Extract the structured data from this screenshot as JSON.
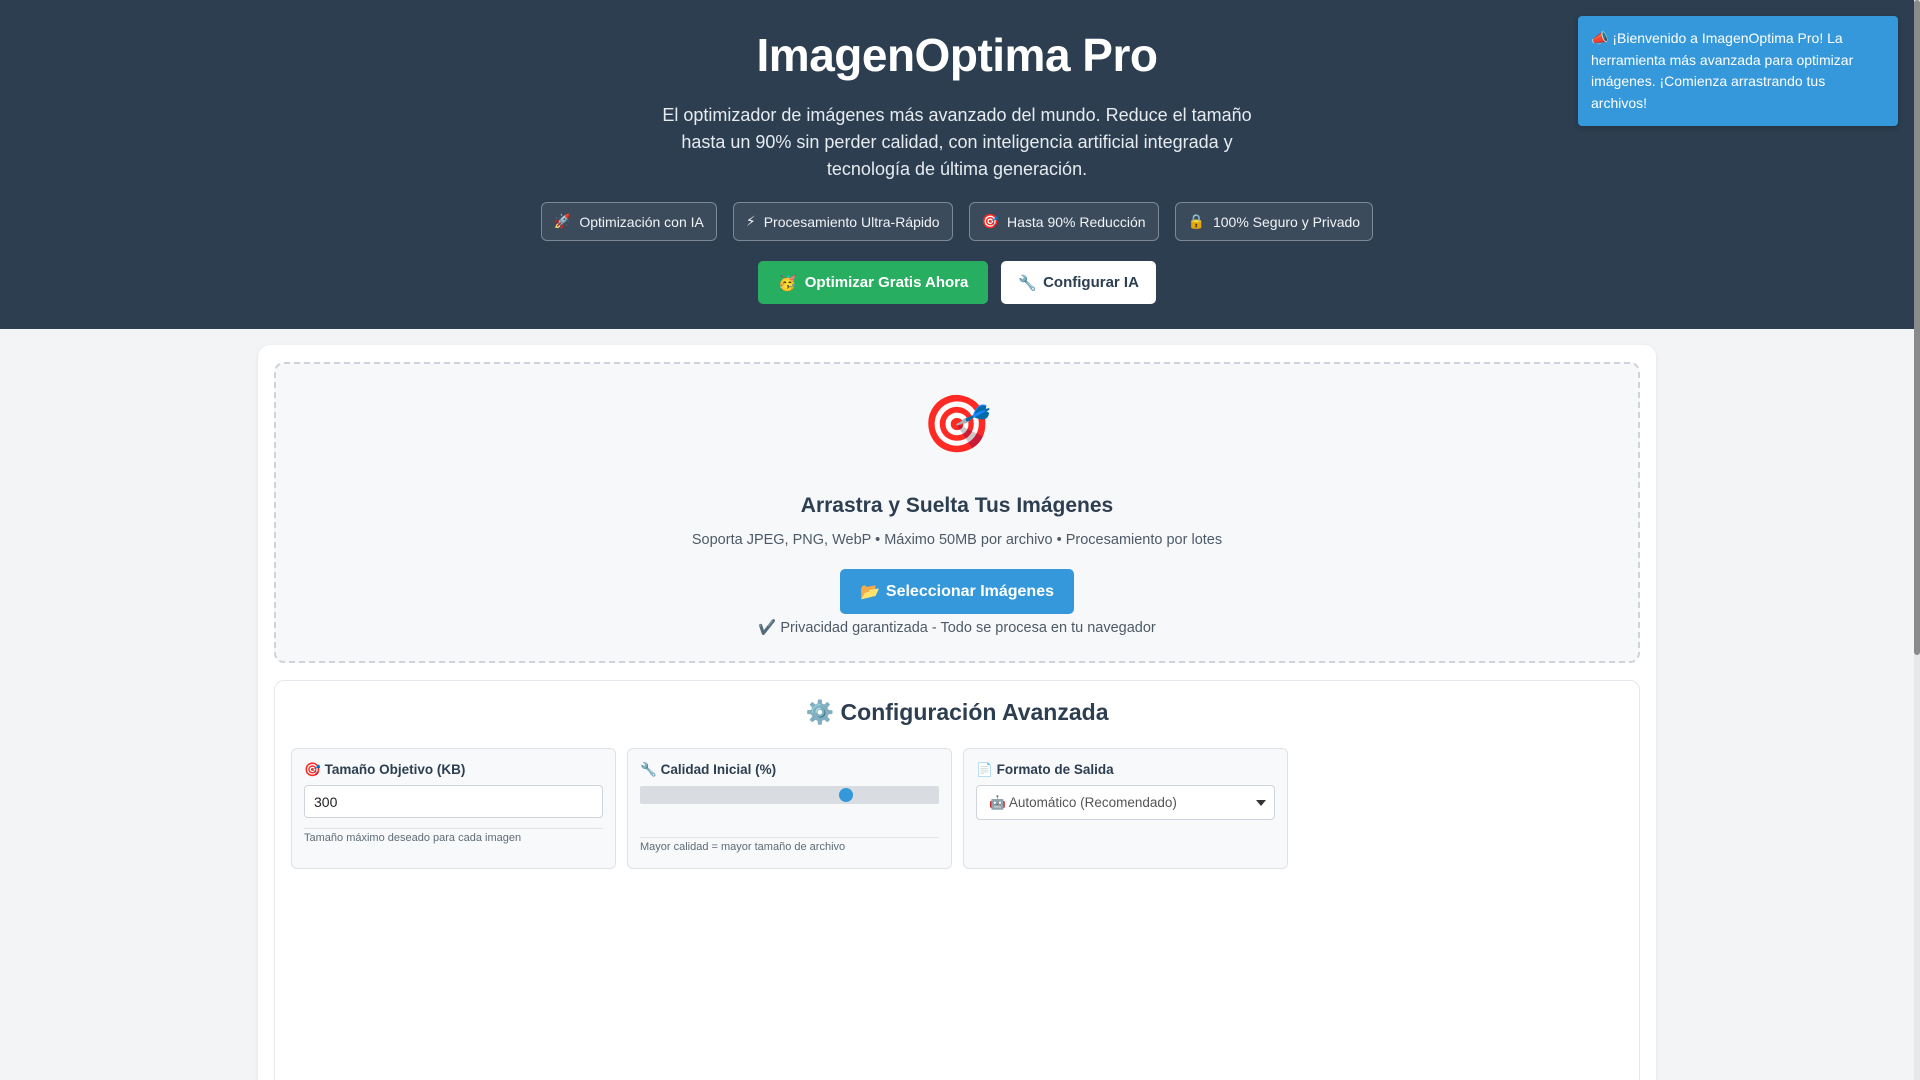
{
  "toast": {
    "icon": "📣",
    "text": "¡Bienvenido a ImagenOptima Pro! La herramienta más avanzada para optimizar imágenes. ¡Comienza arrastrando tus archivos!"
  },
  "hero": {
    "title": "ImagenOptima Pro",
    "subtitle": "El optimizador de imágenes más avanzado del mundo. Reduce el tamaño hasta un 90% sin perder calidad, con inteligencia artificial integrada y tecnología de última generación.",
    "features": [
      {
        "icon": "🚀",
        "label": "Optimización con IA"
      },
      {
        "icon": "⚡",
        "label": "Procesamiento Ultra-Rápido"
      },
      {
        "icon": "🎯",
        "label": "Hasta 90% Reducción"
      },
      {
        "icon": "🔒",
        "label": "100% Seguro y Privado"
      }
    ],
    "primary_button": {
      "icon": "🥳",
      "label": "Optimizar Gratis Ahora"
    },
    "secondary_button": {
      "icon": "🔧",
      "label": "Configurar IA"
    }
  },
  "dropzone": {
    "icon": "🎯",
    "title": "Arrastra y Suelta Tus Imágenes",
    "subtitle": "Soporta JPEG, PNG, WebP • Máximo 50MB por archivo • Procesamiento por lotes",
    "button": {
      "icon": "📂",
      "label": "Seleccionar Imágenes"
    },
    "privacy": {
      "icon": "✔️",
      "text": "Privacidad garantizada - Todo se procesa en tu navegador"
    }
  },
  "config": {
    "title_icon": "⚙️",
    "title": "Configuración Avanzada",
    "target_size": {
      "icon": "🎯",
      "label": "Tamaño Objetivo (KB)",
      "value": "300",
      "help": "Tamaño máximo deseado para cada imagen"
    },
    "quality": {
      "icon": "🔧",
      "label": "Calidad Inicial (%)",
      "value_fraction": 0.69,
      "help": "Mayor calidad = mayor tamaño de archivo"
    },
    "format": {
      "icon": "📄",
      "label": "Formato de Salida",
      "selected": "🤖 Automático (Recomendado)"
    }
  },
  "colors": {
    "header_bg": "#2c3e50",
    "accent_blue": "#3498db",
    "accent_green": "#27ae60"
  }
}
